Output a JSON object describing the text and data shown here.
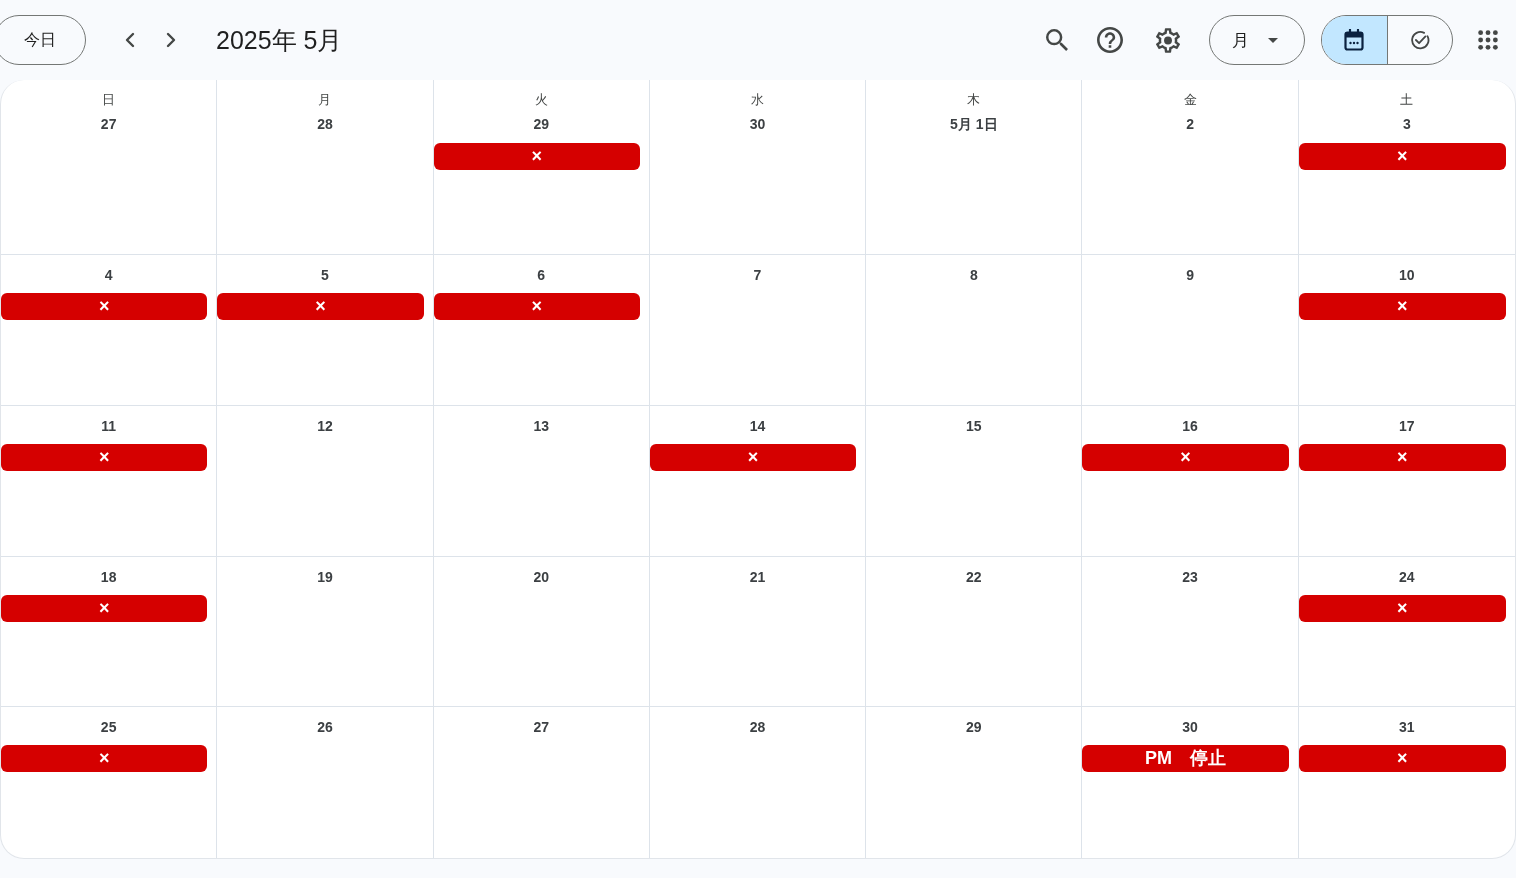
{
  "header": {
    "today_button": "今日",
    "title": "2025年 5月",
    "view_dropdown": "月",
    "view_toggle": [
      {
        "kind": "calendar",
        "selected": true
      },
      {
        "kind": "tasks",
        "selected": false
      }
    ]
  },
  "calendar": {
    "weekdays": [
      "日",
      "月",
      "火",
      "水",
      "木",
      "金",
      "土"
    ],
    "weeks": [
      [
        {
          "date": "27"
        },
        {
          "date": "28"
        },
        {
          "date": "29",
          "events": [
            {
              "title": "×"
            }
          ]
        },
        {
          "date": "30"
        },
        {
          "date": "5月 1日"
        },
        {
          "date": "2"
        },
        {
          "date": "3",
          "events": [
            {
              "title": "×"
            }
          ]
        }
      ],
      [
        {
          "date": "4",
          "events": [
            {
              "title": "×"
            }
          ]
        },
        {
          "date": "5",
          "events": [
            {
              "title": "×"
            }
          ]
        },
        {
          "date": "6",
          "events": [
            {
              "title": "×"
            }
          ]
        },
        {
          "date": "7"
        },
        {
          "date": "8"
        },
        {
          "date": "9"
        },
        {
          "date": "10",
          "events": [
            {
              "title": "×"
            }
          ]
        }
      ],
      [
        {
          "date": "11",
          "events": [
            {
              "title": "×"
            }
          ]
        },
        {
          "date": "12"
        },
        {
          "date": "13"
        },
        {
          "date": "14",
          "events": [
            {
              "title": "×"
            }
          ]
        },
        {
          "date": "15"
        },
        {
          "date": "16",
          "events": [
            {
              "title": "×"
            }
          ]
        },
        {
          "date": "17",
          "events": [
            {
              "title": "×"
            }
          ]
        }
      ],
      [
        {
          "date": "18",
          "events": [
            {
              "title": "×"
            }
          ]
        },
        {
          "date": "19"
        },
        {
          "date": "20"
        },
        {
          "date": "21"
        },
        {
          "date": "22"
        },
        {
          "date": "23"
        },
        {
          "date": "24",
          "events": [
            {
              "title": "×"
            }
          ]
        }
      ],
      [
        {
          "date": "25",
          "events": [
            {
              "title": "×"
            }
          ]
        },
        {
          "date": "26"
        },
        {
          "date": "27"
        },
        {
          "date": "28"
        },
        {
          "date": "29"
        },
        {
          "date": "30",
          "events": [
            {
              "title": "PM　停止"
            }
          ]
        },
        {
          "date": "31",
          "events": [
            {
              "title": "×"
            }
          ]
        }
      ]
    ]
  }
}
